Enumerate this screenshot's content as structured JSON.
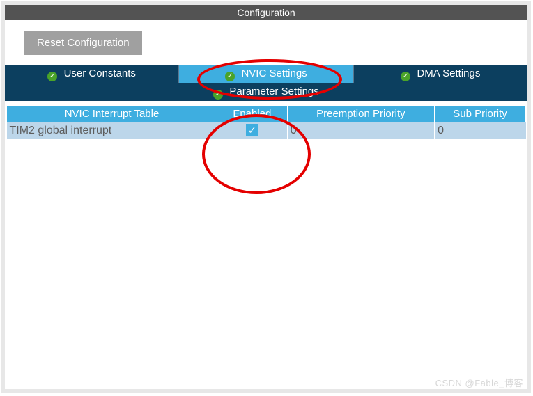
{
  "window": {
    "title": "Configuration"
  },
  "toolbar": {
    "reset_label": "Reset Configuration"
  },
  "tabs": {
    "user_constants": "User Constants",
    "nvic_settings": "NVIC Settings",
    "dma_settings": "DMA Settings",
    "parameter_settings": "Parameter Settings"
  },
  "table": {
    "columns": {
      "name": "NVIC Interrupt Table",
      "enabled": "Enabled",
      "preempt": "Preemption Priority",
      "sub": "Sub Priority"
    },
    "rows": [
      {
        "name": "TIM2 global interrupt",
        "enabled": true,
        "preempt": "0",
        "sub": "0"
      }
    ]
  },
  "watermark": "CSDN @Fable_博客"
}
